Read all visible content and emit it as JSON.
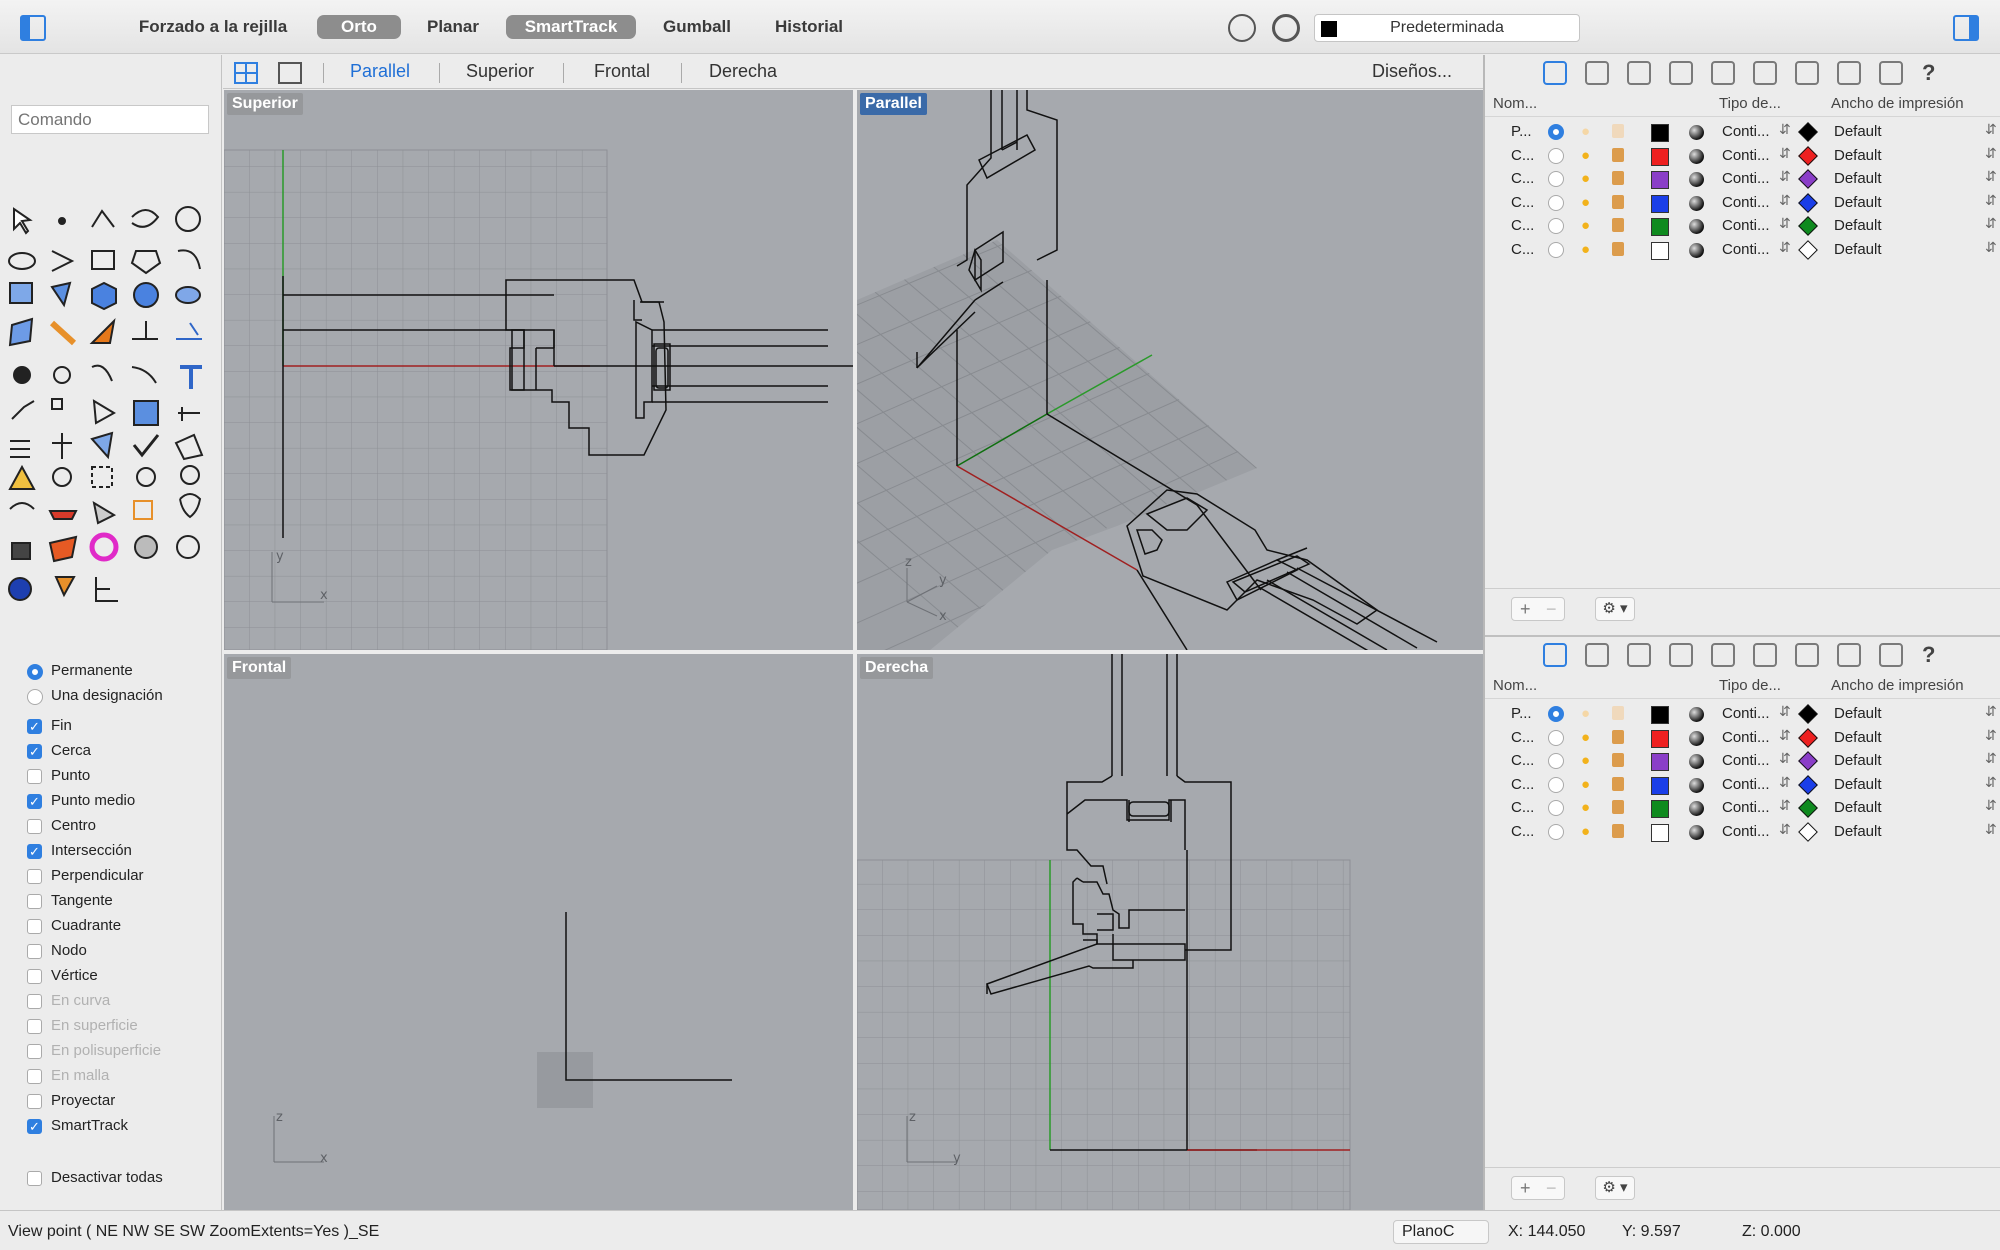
{
  "topbar": {
    "buttons": [
      {
        "label": "Forzado a la rejilla",
        "on": false
      },
      {
        "label": "Orto",
        "on": true
      },
      {
        "label": "Planar",
        "on": false
      },
      {
        "label": "SmartTrack",
        "on": true
      },
      {
        "label": "Gumball",
        "on": false
      },
      {
        "label": "Historial",
        "on": false
      }
    ],
    "layer_combo": "Predeterminada"
  },
  "command": {
    "placeholder": "Comando"
  },
  "osnap": {
    "mode": [
      {
        "label": "Permanente",
        "on": true
      },
      {
        "label": "Una designación",
        "on": false
      }
    ],
    "items": [
      {
        "label": "Fin",
        "on": true,
        "disabled": false
      },
      {
        "label": "Cerca",
        "on": true,
        "disabled": false
      },
      {
        "label": "Punto",
        "on": false,
        "disabled": false
      },
      {
        "label": "Punto medio",
        "on": true,
        "disabled": false
      },
      {
        "label": "Centro",
        "on": false,
        "disabled": false
      },
      {
        "label": "Intersección",
        "on": true,
        "disabled": false
      },
      {
        "label": "Perpendicular",
        "on": false,
        "disabled": false
      },
      {
        "label": "Tangente",
        "on": false,
        "disabled": false
      },
      {
        "label": "Cuadrante",
        "on": false,
        "disabled": false
      },
      {
        "label": "Nodo",
        "on": false,
        "disabled": false
      },
      {
        "label": "Vértice",
        "on": false,
        "disabled": false
      },
      {
        "label": "En curva",
        "on": false,
        "disabled": true
      },
      {
        "label": "En superficie",
        "on": false,
        "disabled": true
      },
      {
        "label": "En polisuperficie",
        "on": false,
        "disabled": true
      },
      {
        "label": "En malla",
        "on": false,
        "disabled": true
      },
      {
        "label": "Proyectar",
        "on": false,
        "disabled": false
      },
      {
        "label": "SmartTrack",
        "on": true,
        "disabled": false
      }
    ],
    "disable_all": {
      "label": "Desactivar todas",
      "on": false
    }
  },
  "viewport_tabs": {
    "tabs": [
      "Parallel",
      "Superior",
      "Frontal",
      "Derecha"
    ],
    "active": "Parallel",
    "layouts_label": "Diseños..."
  },
  "viewports": {
    "top": "Superior",
    "parallel": "Parallel",
    "front": "Frontal",
    "right": "Derecha",
    "axis_x": "x",
    "axis_y": "y",
    "axis_z": "z"
  },
  "layers_panel": {
    "headers": {
      "name": "Nom...",
      "linetype": "Tipo de...",
      "print_width": "Ancho de impresión"
    },
    "rows": [
      {
        "name": "P...",
        "current": true,
        "color": "#000000",
        "linetype": "Conti...",
        "print_color": "#000000",
        "print_width": "Default"
      },
      {
        "name": "C...",
        "current": false,
        "color": "#ee2020",
        "linetype": "Conti...",
        "print_color": "#ee2020",
        "print_width": "Default"
      },
      {
        "name": "C...",
        "current": false,
        "color": "#8a3ec8",
        "linetype": "Conti...",
        "print_color": "#8a3ec8",
        "print_width": "Default"
      },
      {
        "name": "C...",
        "current": false,
        "color": "#1a3ee8",
        "linetype": "Conti...",
        "print_color": "#1a3ee8",
        "print_width": "Default"
      },
      {
        "name": "C...",
        "current": false,
        "color": "#0e8a1e",
        "linetype": "Conti...",
        "print_color": "#0e8a1e",
        "print_width": "Default"
      },
      {
        "name": "C...",
        "current": false,
        "color": "#ffffff",
        "linetype": "Conti...",
        "print_color": "#ffffff",
        "print_width": "Default"
      }
    ],
    "add_label": "+",
    "remove_label": "−",
    "gear_label": "⚙ ▾"
  },
  "statusbar": {
    "command_line": "View point ( NE NW SE SW ZoomExtents=Yes )_SE",
    "cplane": "PlanoC",
    "x": "X: 144.050",
    "y": "Y: 9.597",
    "z": "Z: 0.000"
  }
}
